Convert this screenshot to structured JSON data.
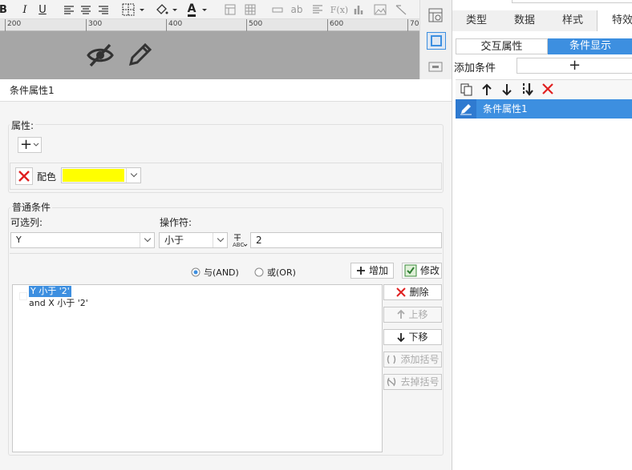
{
  "toolbar": {
    "items": [
      "B",
      "I",
      "U",
      "align-left-icon",
      "align-center-icon",
      "align-right-icon",
      "border-icon",
      "fill-color-icon",
      "font-color-icon",
      "cell-icon",
      "table-icon",
      "widget-icon",
      "ab-icon",
      "text-icon",
      "formula-icon",
      "chart-icon",
      "image-icon",
      "slash-icon"
    ],
    "bold": "B",
    "italic": "I",
    "underline": "U",
    "font_color_letter": "A",
    "ab": "ab",
    "fx": "F(x)"
  },
  "ruler": {
    "ticks": [
      "200",
      "300",
      "400",
      "500",
      "600",
      "70"
    ]
  },
  "right_panel": {
    "tabs": [
      "类型",
      "数据",
      "样式",
      "特效"
    ],
    "seg_interactive": "交互属性",
    "seg_condition": "条件显示",
    "add_condition_label": "添加条件",
    "add_condition_btn": "+",
    "condition_item": "条件属性1"
  },
  "dialog": {
    "title": "条件属性1",
    "attr_legend": "属性:",
    "add_btn": "+",
    "attr_name": "配色",
    "attr_color": "#ffff00",
    "general_legend": "普通条件",
    "column_label": "可选列:",
    "column_value": "Y",
    "operator_label": "操作符:",
    "operator_value": "小于",
    "value": "2",
    "radio_and": "与(AND)",
    "radio_or": "或(OR)",
    "add_cond_btn": "增加",
    "modify_btn": "修改",
    "conditions": [
      "Y 小于 '2'",
      "and X 小于 '2'"
    ],
    "delete_btn": "删除",
    "up_btn": "上移",
    "down_btn": "下移",
    "add_paren_btn": "添加括号",
    "remove_paren_btn": "去掉括号"
  },
  "colors": {
    "accent": "#3d8fe0",
    "canvas_gray": "#a6a6a6",
    "delete_red": "#e02020"
  }
}
